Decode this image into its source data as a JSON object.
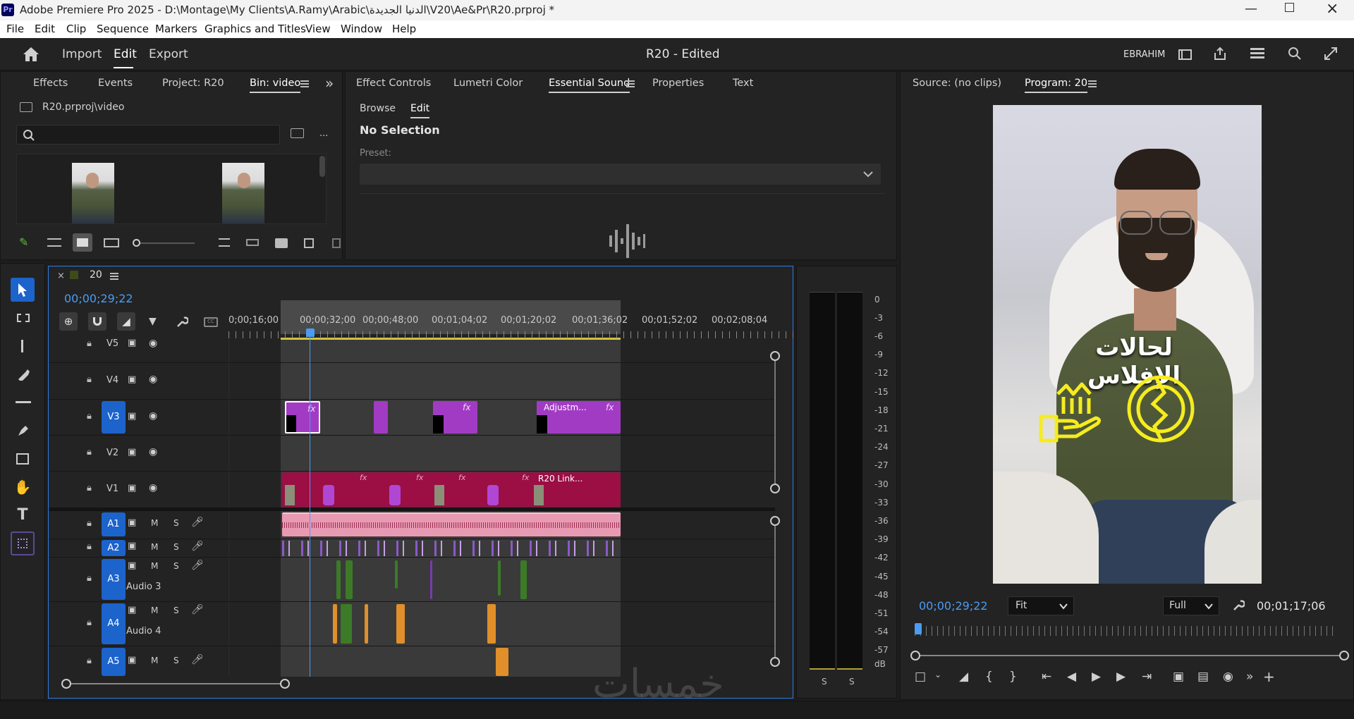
{
  "app": {
    "icon_label": "Pr",
    "window_title": "Adobe Premiere Pro 2025 - D:\\Montage\\My Clients\\A.Ramy\\Arabic\\الدنيا الجديدة\\V20\\Ae&Pr\\R20.prproj *"
  },
  "menu": [
    "File",
    "Edit",
    "Clip",
    "Sequence",
    "Markers",
    "Graphics and Titles",
    "View",
    "Window",
    "Help"
  ],
  "header": {
    "nav": [
      "Import",
      "Edit",
      "Export"
    ],
    "active": "Edit",
    "project_title": "R20 - Edited",
    "user": "EBRAHIM"
  },
  "project_panel": {
    "tabs": [
      "Effects",
      "Events",
      "Project: R20",
      "Bin: video"
    ],
    "active_tab": "Bin: video",
    "path": "R20.prproj\\video",
    "search_placeholder": ""
  },
  "center_panel": {
    "tabs": [
      "Effect Controls",
      "Lumetri Color",
      "Essential Sound",
      "Properties",
      "Text"
    ],
    "active_tab": "Essential Sound",
    "subtabs": [
      "Browse",
      "Edit"
    ],
    "active_subtab": "Edit",
    "status": "No Selection",
    "preset_label": "Preset:"
  },
  "program_monitor": {
    "source_tab": "Source: (no clips)",
    "program_tab": "Program: 20",
    "timecode": "00;00;29;22",
    "fit": "Fit",
    "quality": "Full",
    "duration": "00;01;17;06",
    "overlay_text": "لحالات الإفلاس"
  },
  "timeline": {
    "sequence_name": "20",
    "timecode": "00;00;29;22",
    "ruler": [
      "0;00;16;00",
      "00;00;32;00",
      "00;00;48;00",
      "00;01;04;02",
      "00;01;20;02",
      "00;01;36;02",
      "00;01;52;02",
      "00;02;08;04"
    ],
    "video_tracks": [
      {
        "name": "V5"
      },
      {
        "name": "V4"
      },
      {
        "name": "V3",
        "targeted": true
      },
      {
        "name": "V2"
      },
      {
        "name": "V1"
      }
    ],
    "audio_tracks": [
      {
        "id": "A1",
        "label": ""
      },
      {
        "id": "A2",
        "label": ""
      },
      {
        "id": "A3",
        "label": "Audio 3"
      },
      {
        "id": "A4",
        "label": "Audio 4"
      },
      {
        "id": "A5",
        "label": ""
      }
    ],
    "clip_labels": {
      "adjustment": "Adjustm...",
      "linked": "R20 Link...",
      "fx": "fx"
    },
    "track_buttons": {
      "mute": "M",
      "solo": "S"
    }
  },
  "audio_meter": {
    "scale": [
      "0",
      "-3",
      "-6",
      "-9",
      "-12",
      "-15",
      "-18",
      "-21",
      "-24",
      "-27",
      "-30",
      "-33",
      "-36",
      "-39",
      "-42",
      "-45",
      "-48",
      "-51",
      "-54",
      "-57",
      "dB"
    ],
    "solo_labels": [
      "S",
      "S"
    ]
  },
  "watermark": "خمسات",
  "colors": {
    "accent_blue": "#2d8ceb",
    "track_blue": "#1c63cc",
    "clip_purple": "#a23bc4",
    "clip_crimson": "#9b0f45",
    "audio_pink": "#e99ab3",
    "audio_green": "#3c7a27",
    "audio_orange": "#e08f2a"
  }
}
